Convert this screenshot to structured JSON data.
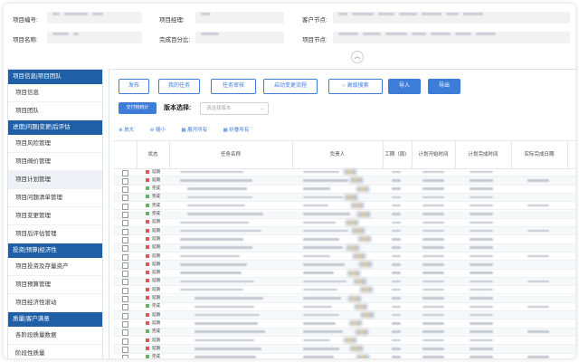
{
  "header": {
    "labels": {
      "project_no": "项目编号:",
      "manager": "项目经理:",
      "customer_node": "客户节点:",
      "project_name": "项目名称:",
      "progress": "完成百分比:",
      "project_node": "项目节点:"
    }
  },
  "sidebar": {
    "sections": [
      {
        "title": "项目信息|项目团队",
        "items": [
          "项目信息",
          "项目团队"
        ]
      },
      {
        "title": "进度|问题|变更|后评估",
        "items": [
          "项目风险管理",
          "项目阀价管理",
          "项目计划管理",
          "项目问题清单管理",
          "项目变更管理",
          "项目后评估管理"
        ]
      },
      {
        "title": "投资|预算|经济性",
        "items": [
          "项目投资及存量资产",
          "项目预算管理",
          "项目经济性滚动"
        ]
      },
      {
        "title": "质量|客户满意",
        "items": [
          "各阶段质量数据",
          "阶段性质量"
        ]
      }
    ],
    "active_item": "项目计划管理"
  },
  "toolbar": {
    "buttons": [
      {
        "label": "发布",
        "solid": false
      },
      {
        "label": "我的任务",
        "solid": false
      },
      {
        "label": "任务审核",
        "solid": false
      },
      {
        "label": "启动变更流程",
        "solid": false
      },
      {
        "label": "高级搜索",
        "solid": false
      },
      {
        "label": "导入",
        "solid": true
      },
      {
        "label": "导出",
        "solid": true
      }
    ],
    "small_button": "交付物统计",
    "version_label": "版本选择:",
    "version_placeholder": "请选择版本",
    "tools": [
      "放大",
      "缩小",
      "展开所有",
      "折叠所有"
    ]
  },
  "table": {
    "columns": [
      "状态",
      "任务名称",
      "负责人",
      "工期（周）",
      "计划开始时间",
      "计划完成时间",
      "实际完成日期"
    ],
    "rows": [
      {
        "status": "延期",
        "color": "#e05555"
      },
      {
        "status": "延期",
        "color": "#e05555"
      },
      {
        "status": "完成",
        "color": "#5cb85c"
      },
      {
        "status": "完成",
        "color": "#5cb85c"
      },
      {
        "status": "完成",
        "color": "#5cb85c"
      },
      {
        "status": "完成",
        "color": "#5cb85c"
      },
      {
        "status": "延期",
        "color": "#e05555"
      },
      {
        "status": "延期",
        "color": "#e05555"
      },
      {
        "status": "延期",
        "color": "#e05555"
      },
      {
        "status": "延期",
        "color": "#e05555"
      },
      {
        "status": "延期",
        "color": "#e05555"
      },
      {
        "status": "延期",
        "color": "#e05555"
      },
      {
        "status": "延期",
        "color": "#e05555"
      },
      {
        "status": "延期",
        "color": "#e05555"
      },
      {
        "status": "延期",
        "color": "#e05555"
      },
      {
        "status": "延期",
        "color": "#e05555"
      },
      {
        "status": "完成",
        "color": "#5cb85c"
      },
      {
        "status": "延期",
        "color": "#e05555"
      },
      {
        "status": "延期",
        "color": "#e05555"
      },
      {
        "status": "完成",
        "color": "#5cb85c"
      },
      {
        "status": "延期",
        "color": "#e05555"
      },
      {
        "status": "延期",
        "color": "#e05555"
      },
      {
        "status": "完成",
        "color": "#5cb85c"
      }
    ]
  },
  "colors": {
    "accent": "#3d7dd8",
    "sidebar_head": "#1f5fa6",
    "delay": "#e05555",
    "done": "#5cb85c"
  },
  "icons": {
    "collapse": "chevron-up-icon",
    "search": "search-icon"
  }
}
